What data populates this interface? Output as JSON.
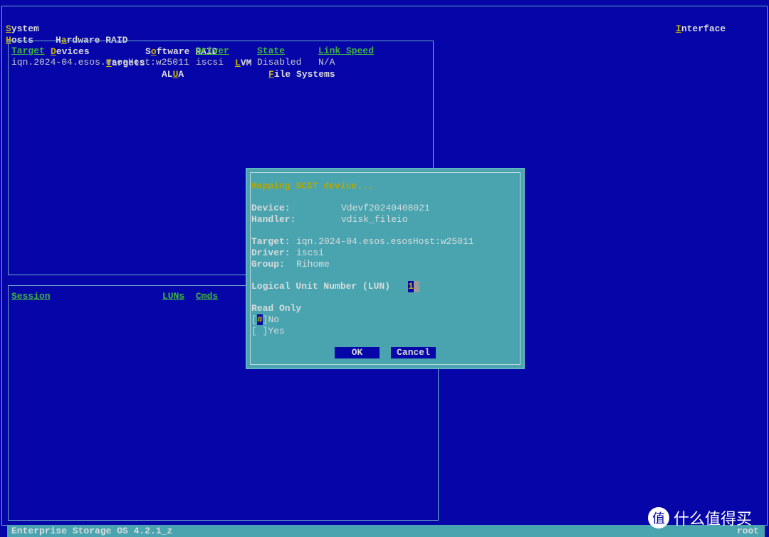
{
  "menu": {
    "row1": [
      {
        "pre": "",
        "hk": "S",
        "post": "ystem"
      },
      {
        "pre": "H",
        "hk": "a",
        "post": "rdware RAID"
      },
      {
        "pre": "S",
        "hk": "o",
        "post": "ftware RAID"
      },
      {
        "pre": "",
        "hk": "L",
        "post": "VM"
      },
      {
        "pre": "",
        "hk": "F",
        "post": "ile Systems"
      }
    ],
    "row2": [
      {
        "pre": "",
        "hk": "H",
        "post": "osts"
      },
      {
        "pre": "",
        "hk": "D",
        "post": "evices"
      },
      {
        "pre": "",
        "hk": "T",
        "post": "argets"
      },
      {
        "pre": "AL",
        "hk": "U",
        "post": "A"
      }
    ],
    "interface": {
      "pre": "",
      "hk": "I",
      "post": "nterface"
    }
  },
  "targets": {
    "headers": [
      "Target",
      "Driver",
      "State",
      "Link Speed"
    ],
    "rows": [
      [
        "iqn.2024-04.esos.esosHost:w25011",
        "iscsi",
        "Disabled",
        "N/A"
      ]
    ]
  },
  "sessions": {
    "headers": [
      "Session",
      "LUNs",
      "Cmds"
    ]
  },
  "dialog": {
    "title": "Mapping SCST device...",
    "device_label": "Device:",
    "device": "Vdevf20240408021",
    "handler_label": "Handler:",
    "handler": "vdisk_fileio",
    "target_label": "Target:",
    "target": "iqn.2024-04.esos.esosHost:w25011",
    "driver_label": "Driver:",
    "driver": "iscsi",
    "group_label": "Group:",
    "group": "Rihome",
    "lun_label": "Logical Unit Number (LUN)",
    "lun": "1",
    "readonly_label": "Read Only",
    "options": [
      {
        "mark": "#",
        "label": "No",
        "checked": true
      },
      {
        "mark": " ",
        "label": "Yes",
        "checked": false
      }
    ],
    "ok": "OK",
    "cancel": "Cancel"
  },
  "status": {
    "left": "Enterprise Storage OS 4.2.1_z",
    "right": "root"
  },
  "watermark": {
    "text": "什么值得买",
    "logo": "值"
  },
  "colors": {
    "background": "#0606a8",
    "dialog": "#4aa4b0",
    "hotkey": "#c8b400",
    "header": "#3fb53f"
  }
}
